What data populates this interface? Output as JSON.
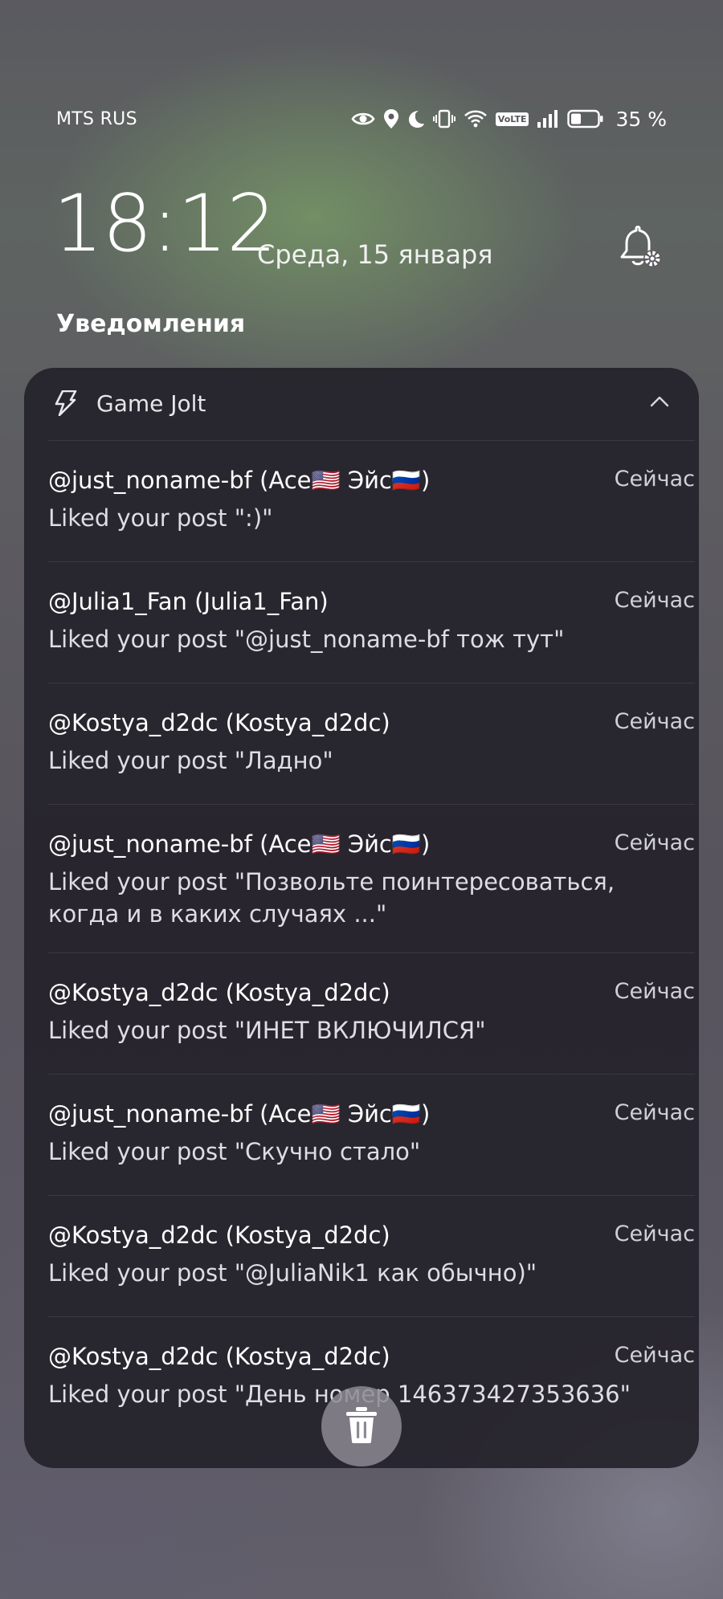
{
  "status_bar": {
    "carrier": "MTS RUS",
    "volte_label": "VoLTE",
    "battery": "35 %",
    "icons": [
      "eye-icon",
      "location-icon",
      "moon-icon",
      "vibrate-icon",
      "wifi-icon",
      "volte-icon",
      "signal-icon",
      "battery-icon"
    ]
  },
  "lockscreen": {
    "time": "18:12",
    "date": "Среда, 15 января",
    "settings_icon": "bell-settings-icon"
  },
  "section_heading": "Уведомления",
  "notification_group": {
    "app_name": "Game Jolt",
    "app_icon": "game-jolt-bolt-icon",
    "collapse_icon": "chevron-up-icon",
    "items": [
      {
        "title": "@just_noname-bf (Ace🇺🇸 Эйс🇷🇺)",
        "body": "Liked your post \":)\"",
        "time": "Сейчас"
      },
      {
        "title": "@Julia1_Fan (Julia1_Fan)",
        "body": "Liked your post \"@just_noname-bf тож тут\"",
        "time": "Сейчас"
      },
      {
        "title": "@Kostya_d2dc (Kostya_d2dc)",
        "body": "Liked your post \"Ладно\"",
        "time": "Сейчас"
      },
      {
        "title": "@just_noname-bf (Ace🇺🇸 Эйс🇷🇺)",
        "body": "Liked your post \"Позвольте поинтересоваться, когда и в каких случаях ...\"",
        "time": "Сейчас"
      },
      {
        "title": "@Kostya_d2dc (Kostya_d2dc)",
        "body": "Liked your post \"ИНЕТ ВКЛЮЧИЛСЯ\"",
        "time": "Сейчас"
      },
      {
        "title": "@just_noname-bf (Ace🇺🇸 Эйс🇷🇺)",
        "body": "Liked your post \"Скучно стало\"",
        "time": "Сейчас"
      },
      {
        "title": "@Kostya_d2dc (Kostya_d2dc)",
        "body": "Liked your post \"@JuliaNik1 как обычно)\"",
        "time": "Сейчас"
      },
      {
        "title": "@Kostya_d2dc (Kostya_d2dc)",
        "body": "Liked your post \"День номер 146373427353636\"",
        "time": "Сейчас"
      }
    ]
  },
  "trash_button": {
    "icon": "trash-icon"
  }
}
